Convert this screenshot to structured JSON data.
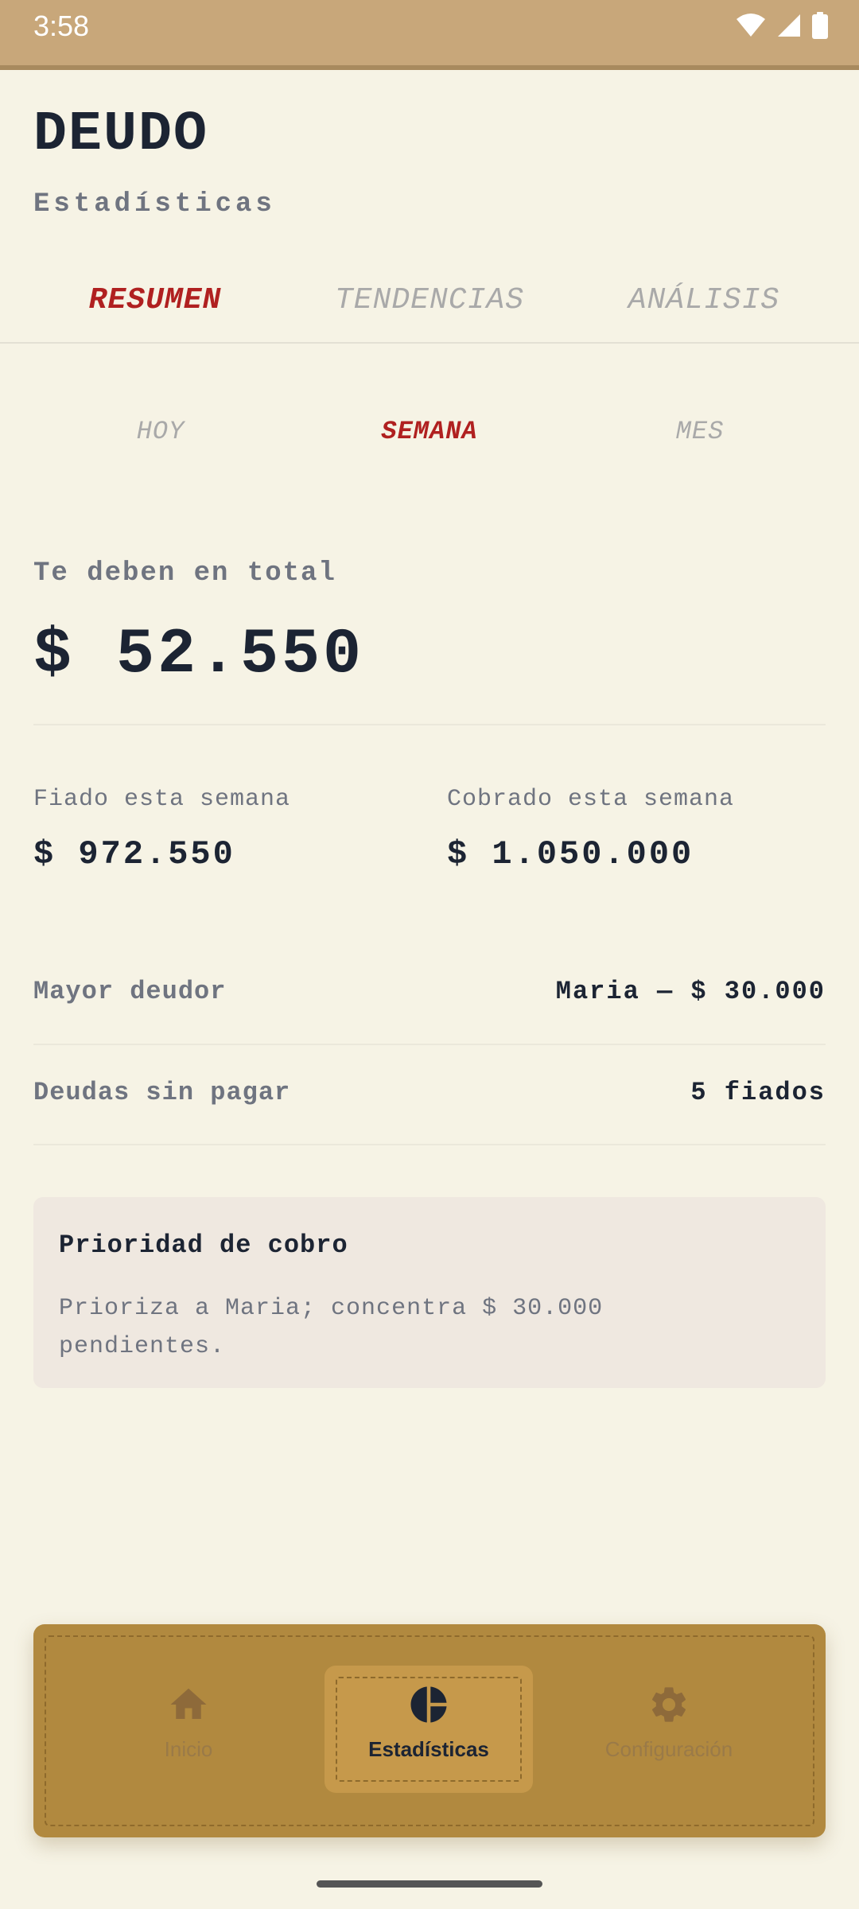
{
  "status_bar": {
    "time": "3:58",
    "icons": [
      "wifi-icon",
      "signal-icon",
      "battery-icon"
    ],
    "color": "#c8a77a"
  },
  "header": {
    "app_title": "DEUDO",
    "subtitle": "Estadísticas"
  },
  "top_tabs": [
    {
      "label": "RESUMEN",
      "active": true
    },
    {
      "label": "TENDENCIAS",
      "active": false
    },
    {
      "label": "ANÁLISIS",
      "active": false
    }
  ],
  "period_tabs": [
    {
      "label": "HOY",
      "active": false
    },
    {
      "label": "SEMANA",
      "active": true
    },
    {
      "label": "MES",
      "active": false
    }
  ],
  "total": {
    "label": "Te deben en total",
    "value": "$ 52.550"
  },
  "stats": {
    "fiado": {
      "label": "Fiado esta semana",
      "value": "$ 972.550"
    },
    "cobrado": {
      "label": "Cobrado esta semana",
      "value": "$ 1.050.000"
    }
  },
  "rows": {
    "mayor_deudor": {
      "label": "Mayor deudor",
      "value": "Maria — $ 30.000"
    },
    "deudas_sin_pagar": {
      "label": "Deudas sin pagar",
      "value": "5 fiados"
    }
  },
  "priority_card": {
    "title": "Prioridad de cobro",
    "text": "Prioriza a Maria; concentra $ 30.000 pendientes."
  },
  "bottom_nav": {
    "items": [
      {
        "label": "Inicio",
        "icon": "home-icon",
        "active": false
      },
      {
        "label": "Estadísticas",
        "icon": "pie-chart-icon",
        "active": true
      },
      {
        "label": "Configuración",
        "icon": "gear-icon",
        "active": false
      }
    ]
  },
  "colors": {
    "background": "#f6f3e5",
    "accent": "#b02020",
    "nav_background": "#b1893f",
    "nav_active": "#c6994b",
    "text_dark": "#1c2433",
    "text_muted": "#6f7480"
  }
}
